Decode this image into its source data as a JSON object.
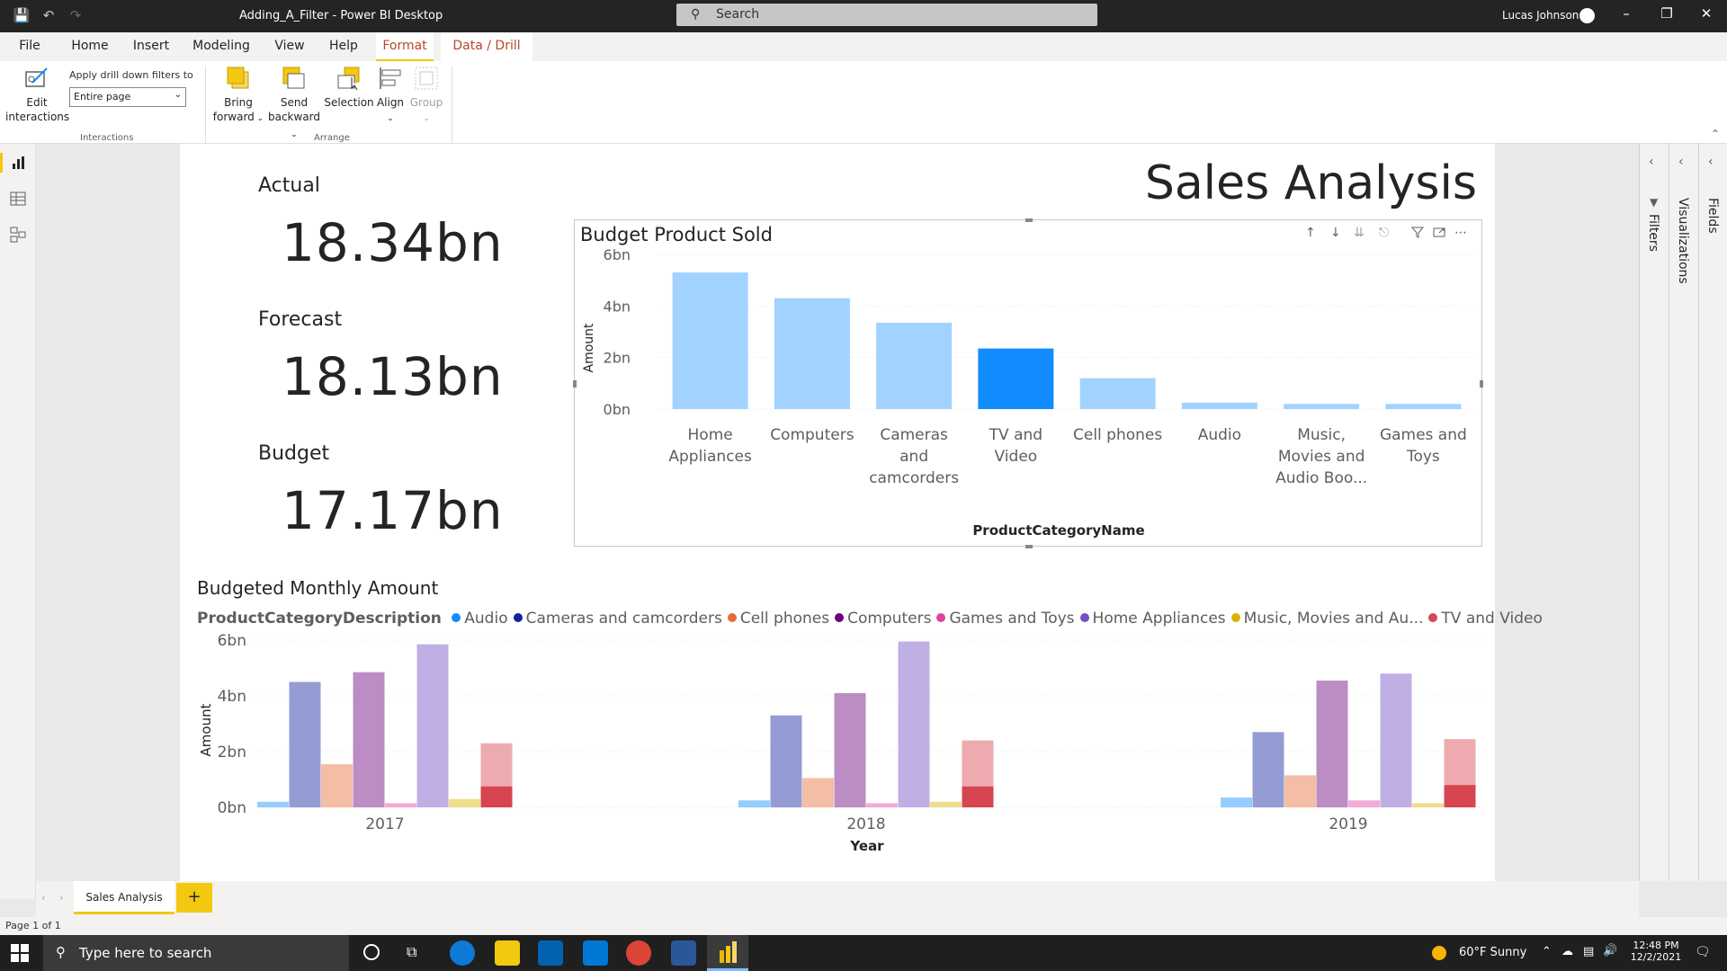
{
  "window": {
    "title": "Adding_A_Filter - Power BI Desktop",
    "search_placeholder": "Search",
    "user": "Lucas Johnson"
  },
  "menu": {
    "tabs": [
      "File",
      "Home",
      "Insert",
      "Modeling",
      "View",
      "Help",
      "Format",
      "Data / Drill"
    ],
    "active": "Format"
  },
  "ribbon": {
    "edit_interactions_1": "Edit",
    "edit_interactions_2": "interactions",
    "drill_label": "Apply drill down filters to",
    "drill_value": "Entire page",
    "interactions_group": "Interactions",
    "bring_forward_1": "Bring",
    "bring_forward_2": "forward",
    "send_backward_1": "Send",
    "send_backward_2": "backward",
    "selection": "Selection",
    "align": "Align",
    "group": "Group",
    "arrange_group": "Arrange"
  },
  "report": {
    "title": "Sales Analysis",
    "cards": [
      {
        "label": "Actual",
        "value": "18.34bn"
      },
      {
        "label": "Forecast",
        "value": "18.13bn"
      },
      {
        "label": "Budget",
        "value": "17.17bn"
      }
    ]
  },
  "chart_data": [
    {
      "type": "bar",
      "title": "Budget Product Sold",
      "xlabel": "ProductCategoryName",
      "ylabel": "Amount",
      "yticks": [
        "0bn",
        "2bn",
        "4bn",
        "6bn"
      ],
      "ylim": [
        0,
        6
      ],
      "categories": [
        [
          "Home",
          "Appliances"
        ],
        [
          "Computers"
        ],
        [
          "Cameras",
          "and",
          "camcorders"
        ],
        [
          "TV and",
          "Video"
        ],
        [
          "Cell phones"
        ],
        [
          "Audio"
        ],
        [
          "Music,",
          "Movies and",
          "Audio Boo..."
        ],
        [
          "Games and",
          "Toys"
        ]
      ],
      "values": [
        5.3,
        4.3,
        3.35,
        2.35,
        1.2,
        0.25,
        0.2,
        0.2
      ],
      "highlight_index": 3,
      "colors": {
        "bar": "#a2d2ff",
        "highlight": "#118dff"
      }
    },
    {
      "type": "bar",
      "title": "Budgeted Monthly Amount",
      "legend_title": "ProductCategoryDescription",
      "xlabel": "Year",
      "ylabel": "Amount",
      "yticks": [
        "0bn",
        "2bn",
        "4bn",
        "6bn"
      ],
      "ylim": [
        0,
        6
      ],
      "categories": [
        "2017",
        "2018",
        "2019"
      ],
      "series": [
        {
          "name": "Audio",
          "color": "#118dff",
          "values": [
            0.2,
            0.25,
            0.35
          ]
        },
        {
          "name": "Cameras and camcorders",
          "color": "#12239e",
          "values": [
            4.5,
            3.3,
            2.7
          ]
        },
        {
          "name": "Cell phones",
          "color": "#e66c37",
          "values": [
            1.55,
            1.05,
            1.15
          ]
        },
        {
          "name": "Computers",
          "color": "#6b007b",
          "values": [
            4.85,
            4.1,
            4.55
          ]
        },
        {
          "name": "Games and Toys",
          "color": "#e044a7",
          "values": [
            0.15,
            0.15,
            0.25
          ]
        },
        {
          "name": "Home Appliances",
          "color": "#744ec2",
          "values": [
            5.85,
            5.95,
            4.8
          ]
        },
        {
          "name": "Music, Movies and Au...",
          "color": "#d9b300",
          "values": [
            0.3,
            0.2,
            0.15
          ]
        },
        {
          "name": "TV and Video",
          "color": "#d64550",
          "values": [
            2.3,
            2.4,
            2.45
          ]
        }
      ],
      "highlight_values": [
        0.75,
        0.75,
        0.8
      ],
      "highlight_series": "TV and Video"
    }
  ],
  "pages": {
    "tabs": [
      "Sales Analysis"
    ],
    "add": "+",
    "status": "Page 1 of 1"
  },
  "panes": {
    "filters": "Filters",
    "visualizations": "Visualizations",
    "fields": "Fields"
  },
  "taskbar": {
    "search_placeholder": "Type here to search",
    "weather": "60°F  Sunny",
    "time": "12:48 PM",
    "date": "12/2/2021"
  }
}
